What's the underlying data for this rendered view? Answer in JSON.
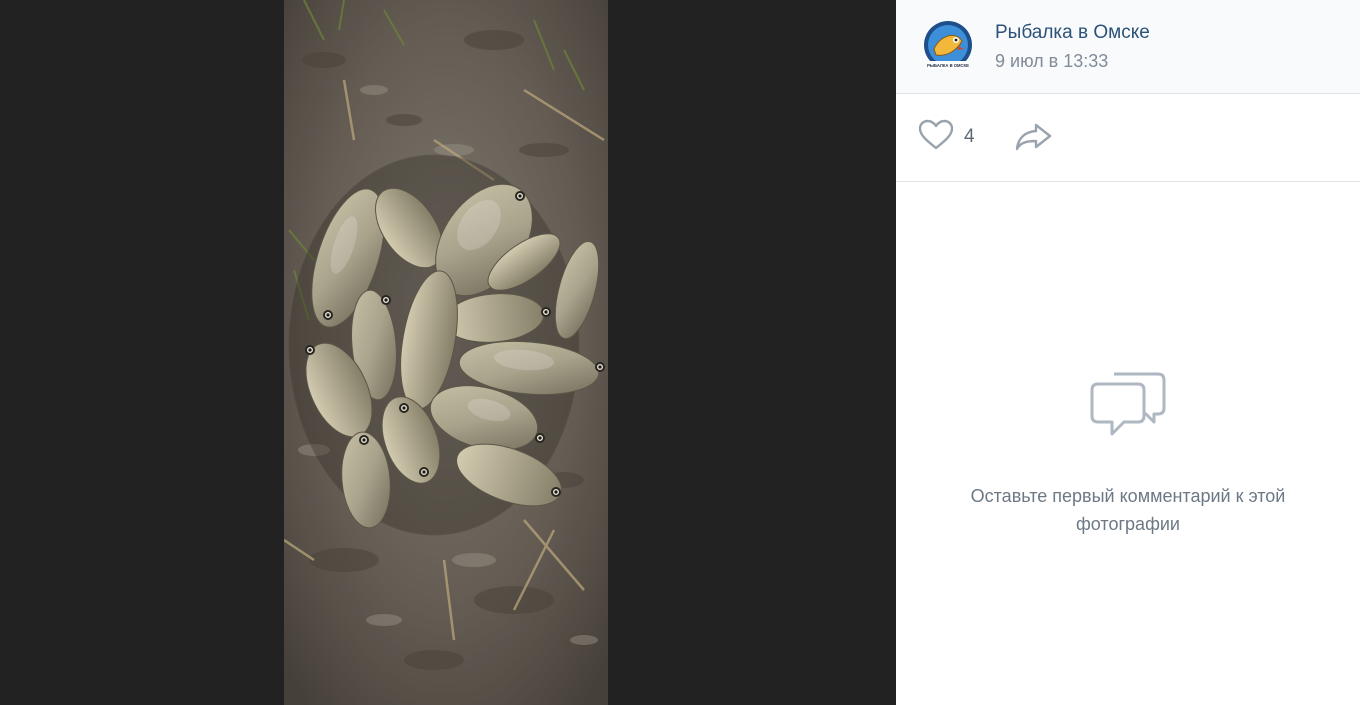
{
  "post": {
    "author": "Рыбалка в Омске",
    "date": "9 июл в 13:33",
    "avatar_text": "РЫБАЛКА В ОМСКЕ"
  },
  "actions": {
    "like_count": "4",
    "like_icon": "heart-outline-icon",
    "share_icon": "share-arrow-icon"
  },
  "comments": {
    "empty_icon": "comment-bubbles-icon",
    "empty_text": "Оставьте первый комментарий к этой фотографии"
  },
  "photo": {
    "subject": "fish-catch-photo"
  },
  "colors": {
    "author": "#2c5279",
    "muted": "#818c99",
    "viewer_bg": "#222222"
  }
}
